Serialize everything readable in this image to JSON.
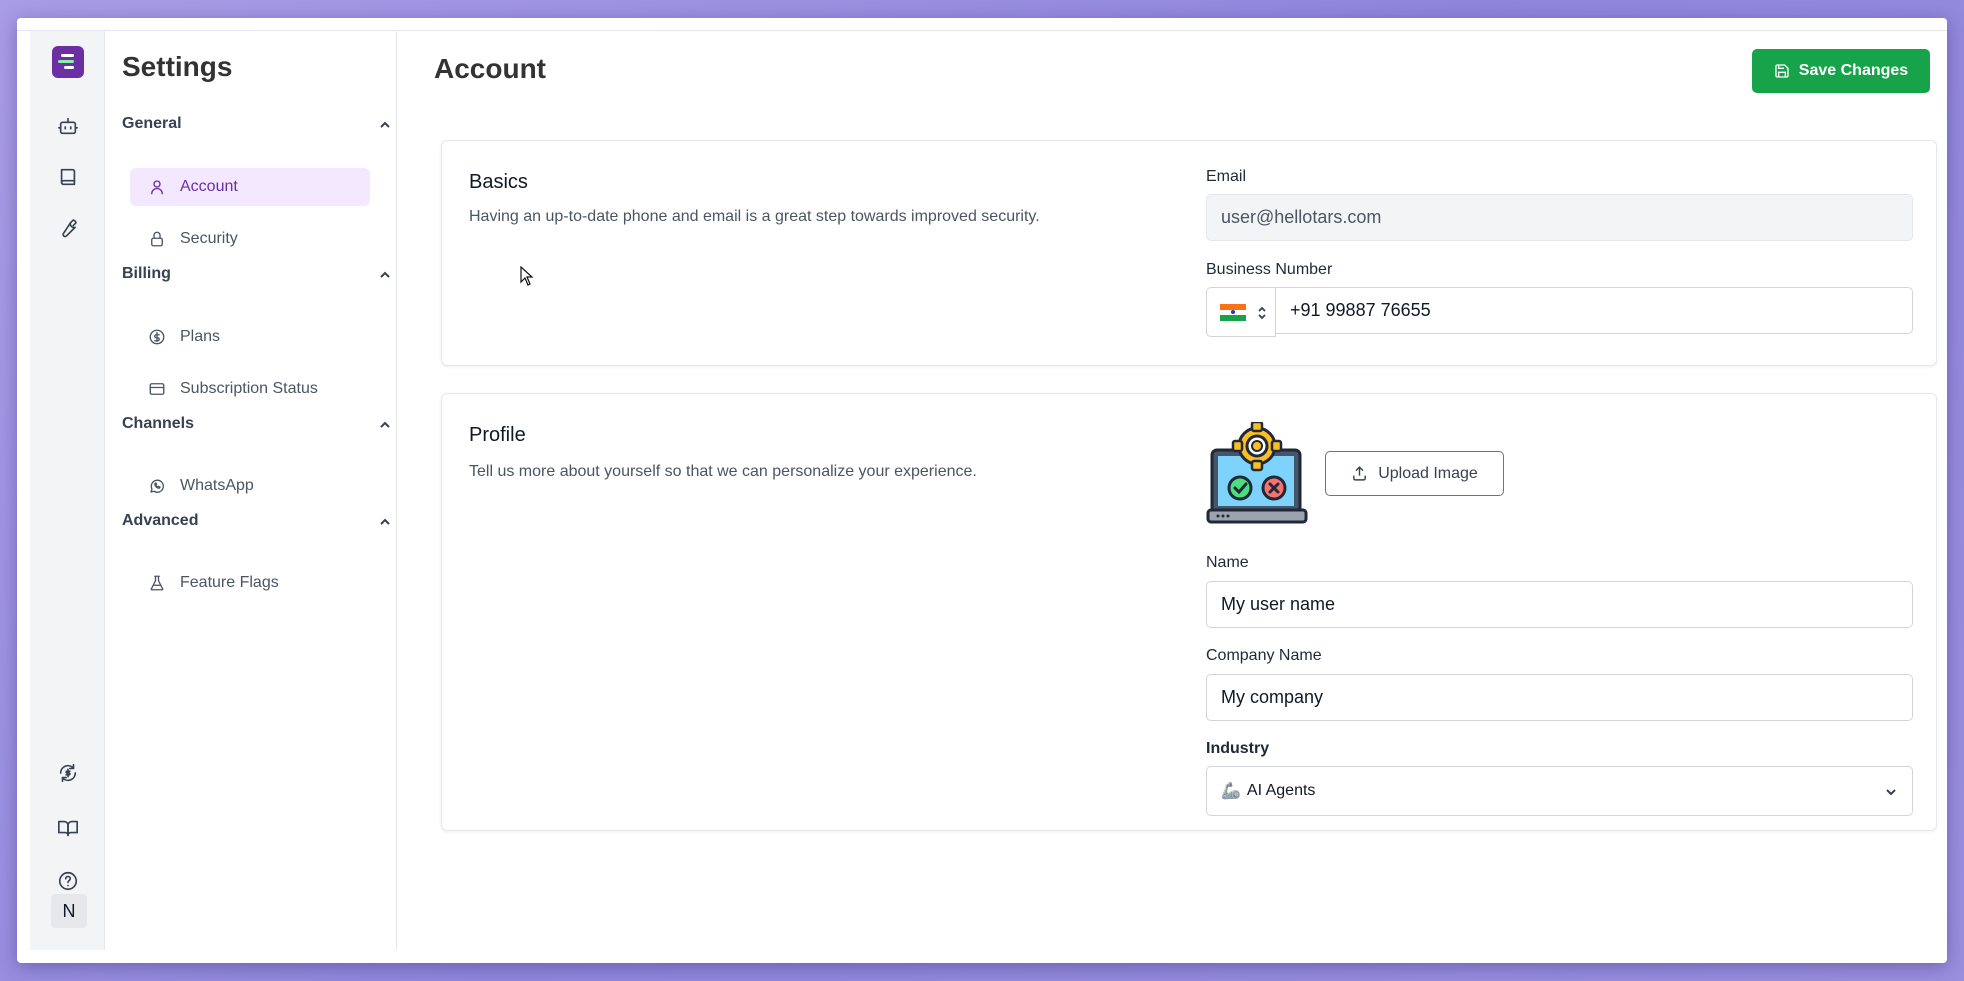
{
  "sidebar": {
    "title": "Settings",
    "groups": [
      {
        "title": "General",
        "items": [
          {
            "label": "Account",
            "icon": "user-icon",
            "active": true
          },
          {
            "label": "Security",
            "icon": "lock-icon"
          }
        ]
      },
      {
        "title": "Billing",
        "items": [
          {
            "label": "Plans",
            "icon": "dollar-circle-icon"
          },
          {
            "label": "Subscription Status",
            "icon": "credit-card-icon"
          }
        ]
      },
      {
        "title": "Channels",
        "items": [
          {
            "label": "WhatsApp",
            "icon": "whatsapp-icon"
          }
        ]
      },
      {
        "title": "Advanced",
        "items": [
          {
            "label": "Feature Flags",
            "icon": "flask-icon"
          }
        ]
      }
    ]
  },
  "rail": {
    "avatar_initial": "N"
  },
  "header": {
    "title": "Account",
    "save_label": "Save Changes"
  },
  "basics": {
    "title": "Basics",
    "description": "Having an up-to-date phone and email is a great step towards improved security.",
    "email_label": "Email",
    "email_value": "user@hellotars.com",
    "phone_label": "Business Number",
    "phone_value": "+91 99887 76655"
  },
  "profile": {
    "title": "Profile",
    "description": "Tell us more about yourself so that we can personalize your experience.",
    "upload_label": "Upload Image",
    "name_label": "Name",
    "name_value": "My user name",
    "company_label": "Company Name",
    "company_value": "My company",
    "industry_label": "Industry",
    "industry_value": "AI Agents",
    "industry_emoji": "🦾"
  },
  "colors": {
    "brand": "#6b2fa3",
    "save": "#16a34a",
    "active_bg": "#f3e8ff"
  }
}
